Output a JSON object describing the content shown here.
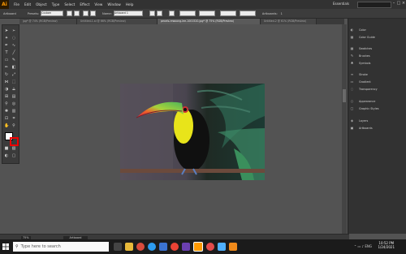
{
  "menubar": {
    "logo": "Ai",
    "items": [
      "File",
      "Edit",
      "Object",
      "Type",
      "Select",
      "Effect",
      "View",
      "Window",
      "Help"
    ],
    "workspace": "Essentials"
  },
  "controlbar": {
    "selection": "Artboard",
    "preset_label": "Presets:",
    "preset_value": "Custom",
    "name_label": "Name:",
    "name_value": "Artboard 1",
    "artboards_label": "Artboards:",
    "artboards_value": "1"
  },
  "tabs": [
    {
      "label": "jpg* @ 74% (RGB/Preview)",
      "active": false
    },
    {
      "label": "Untitled-1.ai @ 66% (RGB/Preview)",
      "active": false
    },
    {
      "label": "pexels-rewoong-lee-1001520.jpg* @ 75% (RGB/Preview)",
      "active": true
    },
    {
      "label": "Untitled-2 @ 61% (RGB/Preview)",
      "active": false
    }
  ],
  "panels": [
    {
      "icon": "color-icon",
      "glyph": "◐",
      "label": "Color"
    },
    {
      "icon": "color-guide-icon",
      "glyph": "▦",
      "label": "Color Guide"
    },
    {
      "icon": "swatches-icon",
      "glyph": "▦",
      "label": "Swatches"
    },
    {
      "icon": "brushes-icon",
      "glyph": "✎",
      "label": "Brushes"
    },
    {
      "icon": "symbols-icon",
      "glyph": "♣",
      "label": "Symbols"
    },
    {
      "icon": "stroke-icon",
      "glyph": "≡",
      "label": "Stroke"
    },
    {
      "icon": "gradient-icon",
      "glyph": "▭",
      "label": "Gradient"
    },
    {
      "icon": "transparency-icon",
      "glyph": "◌",
      "label": "Transparency"
    },
    {
      "icon": "appearance-icon",
      "glyph": "○",
      "label": "Appearance"
    },
    {
      "icon": "graphic-styles-icon",
      "glyph": "▢",
      "label": "Graphic Styles"
    },
    {
      "icon": "layers-icon",
      "glyph": "◈",
      "label": "Layers"
    },
    {
      "icon": "artboards-icon",
      "glyph": "▣",
      "label": "Artboards"
    }
  ],
  "status": {
    "zoom": "75%",
    "artboard_nav": "Artboard"
  },
  "taskbar": {
    "search_placeholder": "Type here to search",
    "time": "10:52 PM",
    "date": "1/24/2021"
  },
  "colors": {
    "accent": "#ff9a00",
    "ui_dark": "#323232",
    "canvas": "#535353"
  }
}
